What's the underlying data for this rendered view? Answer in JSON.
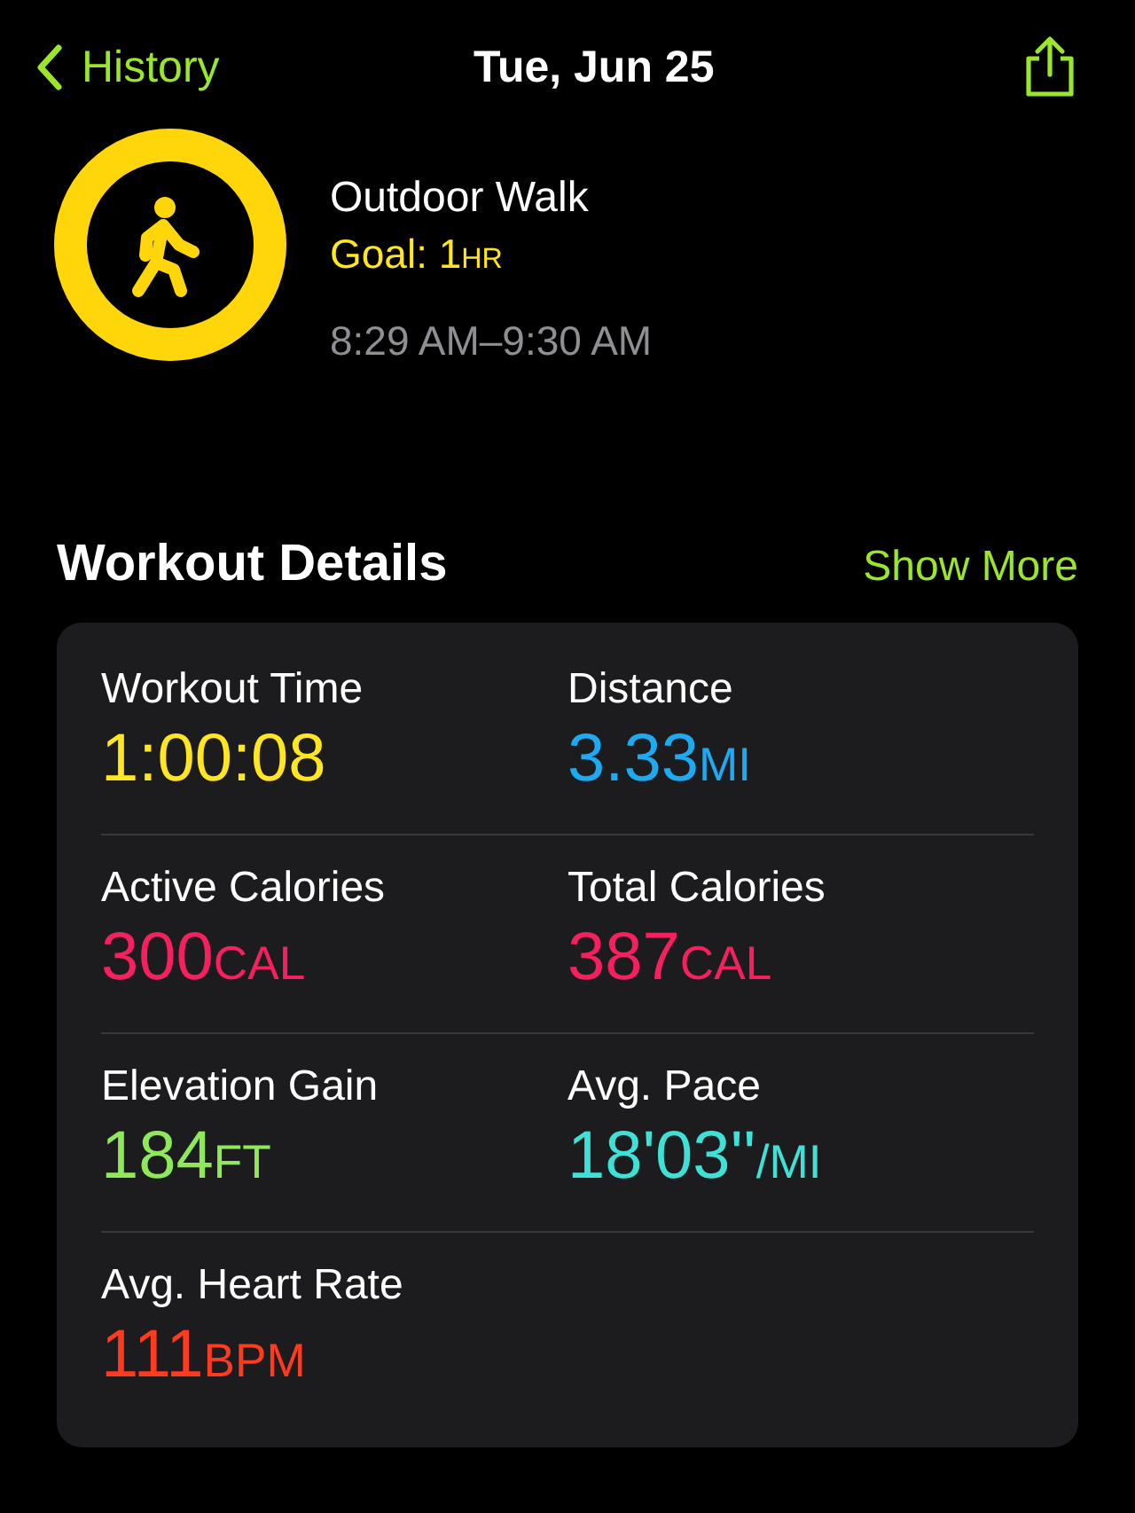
{
  "nav": {
    "back": "History",
    "title": "Tue, Jun 25"
  },
  "workout": {
    "name": "Outdoor Walk",
    "goal_label": "Goal: 1",
    "goal_unit": "HR",
    "time_range": "8:29 AM–9:30 AM"
  },
  "details": {
    "title": "Workout Details",
    "action": "Show More",
    "metrics": [
      {
        "label": "Workout Time",
        "value": "1:00:08",
        "color": "#ffe620"
      },
      {
        "label": "Distance",
        "value": "3.33",
        "unit": "MI",
        "color": "#1eaaf0"
      },
      {
        "label": "Active Calories",
        "value": "300",
        "unit": "CAL",
        "color": "#f5215f"
      },
      {
        "label": "Total Calories",
        "value": "387",
        "unit": "CAL",
        "color": "#f5215f"
      },
      {
        "label": "Elevation Gain",
        "value": "184",
        "unit": "FT",
        "color": "#8fe85a"
      },
      {
        "label": "Avg. Pace",
        "value": "18'03''",
        "unit": "/MI",
        "color": "#3fe0d6"
      },
      {
        "label": "Avg. Heart Rate",
        "value": "111",
        "unit": "BPM",
        "color": "#ff3b1f"
      }
    ]
  }
}
